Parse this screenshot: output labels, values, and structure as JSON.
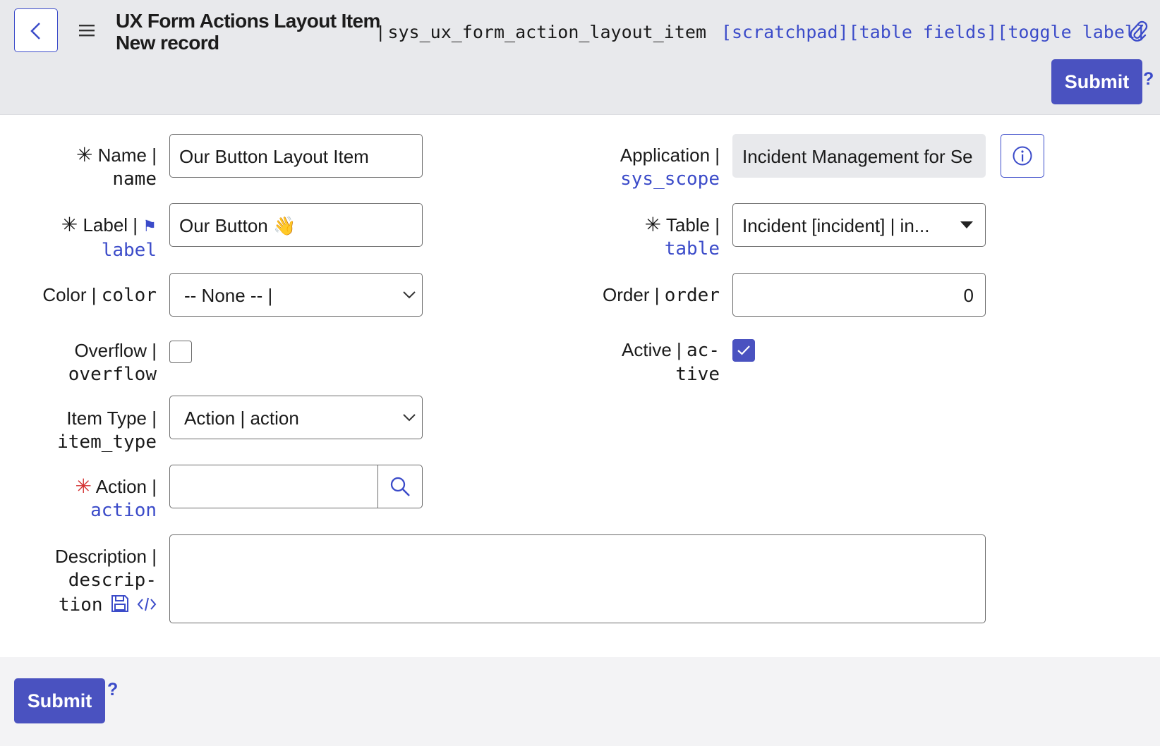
{
  "header": {
    "title_line1": "UX Form Actions Layout Item",
    "title_line2": "New record",
    "table_sep": "|",
    "table_name": "sys_ux_form_action_layout_item",
    "links": [
      "[scratchpad]",
      "[table fields]",
      "[toggle label]"
    ],
    "submit_label": "Submit",
    "help": "?"
  },
  "fields": {
    "name": {
      "label": "Name |",
      "column": "name",
      "value": "Our Button Layout Item"
    },
    "label": {
      "label": "Label |",
      "flag": "⚑",
      "column": "label",
      "value": "Our Button 👋"
    },
    "color": {
      "label": "Color |",
      "column": "color",
      "value": "-- None -- |"
    },
    "overflow": {
      "label": "Overflow |",
      "column": "overflow",
      "checked": false
    },
    "item_type": {
      "label": "Item Type |",
      "column": "item_type",
      "value": "Action | action"
    },
    "action": {
      "label": "Action |",
      "column": "action",
      "value": ""
    },
    "description": {
      "label": "Description |",
      "column_line1": "descrip-",
      "column_line2": "tion",
      "value": ""
    },
    "application": {
      "label": "Application |",
      "column": "sys_scope",
      "value": "Incident Management for Se"
    },
    "table": {
      "label": "Table |",
      "column": "table",
      "value": "Incident [incident] | in..."
    },
    "order": {
      "label": "Order |",
      "column": "order",
      "value": "0"
    },
    "active": {
      "label": "Active |",
      "column_line1": "ac-",
      "column_line2": "tive",
      "checked": true
    }
  },
  "required_mark": "✳",
  "footer": {
    "submit_label": "Submit",
    "help": "?"
  },
  "colors": {
    "accent": "#4a52c0",
    "link": "#3b4bc9",
    "required_red": "#d32f2f",
    "header_bg": "#e8e9ec"
  },
  "icons": [
    "back-chevron-icon",
    "hamburger-menu-icon",
    "paperclip-icon",
    "info-icon",
    "dropdown-caret-icon",
    "search-icon",
    "save-icon",
    "code-icon",
    "checkmark-icon"
  ]
}
